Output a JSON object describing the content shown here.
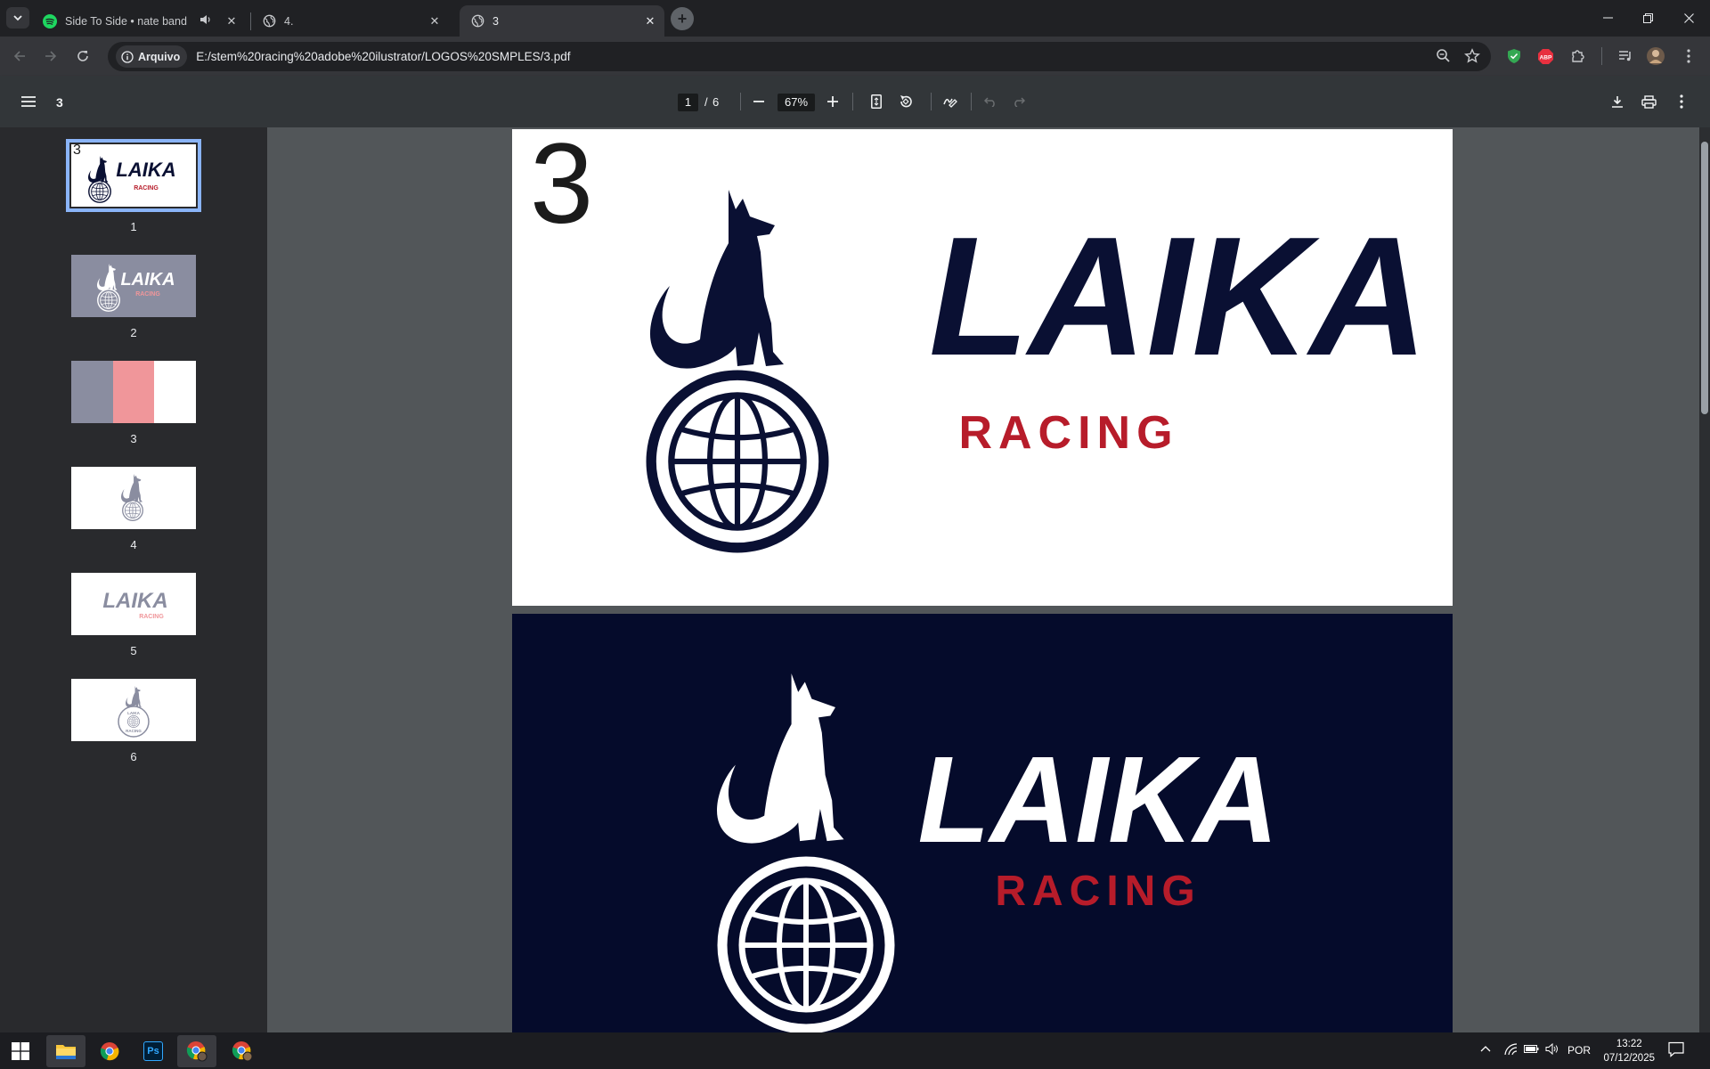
{
  "browser": {
    "tabs": [
      {
        "title": "Side To Side • nate band",
        "favicon": "spotify-icon",
        "audio": true,
        "active": false
      },
      {
        "title": "4.",
        "favicon": "globe-icon",
        "active": false
      },
      {
        "title": "3",
        "favicon": "globe-icon",
        "active": true
      }
    ],
    "omnibox": {
      "security_label": "Arquivo",
      "url": "E:/stem%20racing%20adobe%20ilustrator/LOGOS%20SMPLES/3.pdf"
    },
    "extensions": [
      "shield-extension-icon",
      "adblock-plus-icon",
      "puzzle-extensions-icon"
    ],
    "abp_label": "ABP"
  },
  "pdf_viewer": {
    "title": "3",
    "current_page": "1",
    "page_separator": "/",
    "total_pages": "6",
    "zoom": "67%",
    "thumbnails": [
      {
        "number": "1",
        "variant": "logo-full",
        "selected": true,
        "label": "3"
      },
      {
        "number": "2",
        "variant": "logo-gray"
      },
      {
        "number": "3",
        "variant": "swatches"
      },
      {
        "number": "4",
        "variant": "dog-only"
      },
      {
        "number": "5",
        "variant": "wordmark"
      },
      {
        "number": "6",
        "variant": "badge"
      }
    ],
    "pages": [
      {
        "label": "3",
        "wordmark": "LAIKA",
        "subtitle": "RACING",
        "background": "#ffffff",
        "logo_color": "#0a1033",
        "accent": "#b71c2a"
      },
      {
        "wordmark": "LAIKA",
        "subtitle": "RACING",
        "background": "#050b2b",
        "logo_color": "#ffffff",
        "accent": "#b71c2a"
      }
    ],
    "badge_text": {
      "top": "LAIKA",
      "bottom": "RACING"
    }
  },
  "swatch_colors": [
    "#8a8da0",
    "#f0969a",
    "#ffffff"
  ],
  "taskbar": {
    "apps": [
      "windows-start-icon",
      "file-explorer-icon",
      "chrome-icon",
      "photoshop-icon",
      "chrome-profile-icon",
      "chrome-profile-2-icon"
    ],
    "photoshop_label": "Ps",
    "language": "POR",
    "time": "13:22",
    "date": "07/12/2025"
  }
}
